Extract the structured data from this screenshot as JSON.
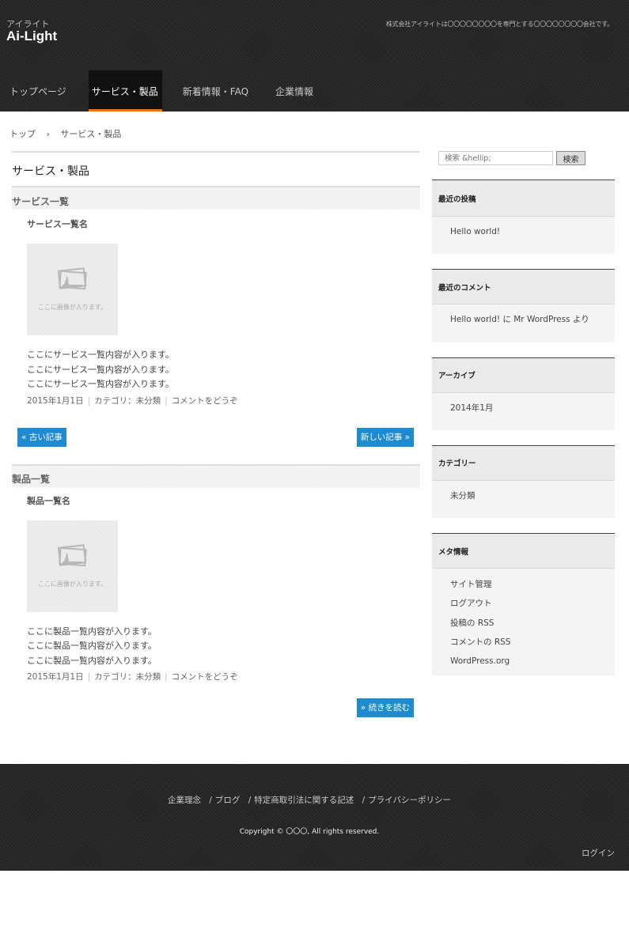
{
  "header": {
    "logo_sub": "アイライト",
    "logo_main": "Ai-Light",
    "tagline": "株式会社アイライトは〇〇〇〇〇〇〇〇を専門とする〇〇〇〇〇〇〇〇会社です。",
    "nav": [
      "トップページ",
      "サービス・製品",
      "新着情報・FAQ",
      "企業情報"
    ],
    "active_nav": "サービス・製品",
    "accent_color": "#e8731a"
  },
  "breadcrumb": {
    "home": "トップ",
    "sep": "›",
    "current": "サービス・製品"
  },
  "main": {
    "page_title": "サービス・製品",
    "sections": [
      {
        "heading": "サービス一覧",
        "post_title": "サービス一覧名",
        "thumb_text": "ここに画像が入ります。",
        "lines": [
          "ここにサービス一覧内容が入ります。",
          "ここにサービス一覧内容が入ります。",
          "ここにサービス一覧内容が入ります。"
        ],
        "date": "2015年1月1日",
        "category": "カテゴリ：未分類",
        "comment": "コメントをどうぞ",
        "older": "« 古い記事",
        "newer": "新しい記事 »"
      },
      {
        "heading": "製品一覧",
        "post_title": "製品一覧名",
        "thumb_text": "ここに画像が入ります。",
        "lines": [
          "ここに製品一覧内容が入ります。",
          "ここに製品一覧内容が入ります。",
          "ここに製品一覧内容が入ります。"
        ],
        "date": "2015年1月1日",
        "category": "カテゴリ：未分類",
        "comment": "コメントをどうぞ",
        "more": "» 続きを読む"
      }
    ],
    "button_color": "#1e8bd0"
  },
  "sidebar": {
    "search_placeholder": "検索 &hellip;",
    "search_button": "検索",
    "widgets": [
      {
        "title": "最近の投稿",
        "items": [
          "Hello world!"
        ]
      },
      {
        "title": "最近のコメント",
        "items": [
          "Hello world! に Mr WordPress より"
        ]
      },
      {
        "title": "アーカイブ",
        "items": [
          "2014年1月"
        ]
      },
      {
        "title": "カテゴリー",
        "items": [
          "未分類"
        ]
      },
      {
        "title": "メタ情報",
        "items": [
          "サイト管理",
          "ログアウト",
          "投稿の RSS",
          "コメントの RSS",
          "WordPress.org"
        ]
      }
    ]
  },
  "footer": {
    "nav": [
      "企業理念",
      "ブログ",
      "特定商取引法に関する記述",
      "プライバシーポリシー"
    ],
    "nav_sep": "/",
    "copyright": "Copyright © 〇〇〇, All rights reserved.",
    "login": "ログイン"
  }
}
